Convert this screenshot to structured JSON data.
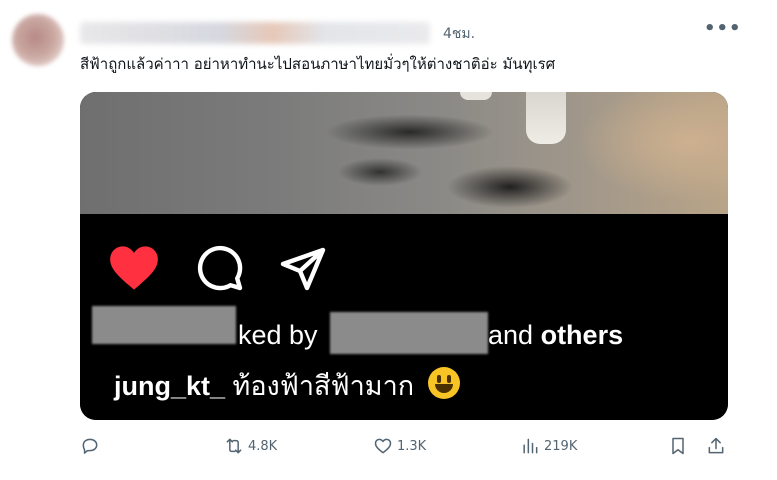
{
  "tweet": {
    "time": "4ชม.",
    "more": "•••",
    "text": "สีฟ้าถูกแล้วค่าาา อย่าหาทำนะไปสอนภาษาไทยมั่วๆให้ต่างชาติอ่ะ มันทุเรศ"
  },
  "media": {
    "liked_by": "ked by",
    "and": "and",
    "others": "others",
    "caption_user": "jung_kt_",
    "caption_text": "ท้องฟ้าสีฟ้ามาก"
  },
  "actions": {
    "replies": "",
    "retweets": "4.8K",
    "likes": "1.3K",
    "views": "219K"
  },
  "colors": {
    "heart": "#ff3040",
    "muted": "#536471"
  }
}
